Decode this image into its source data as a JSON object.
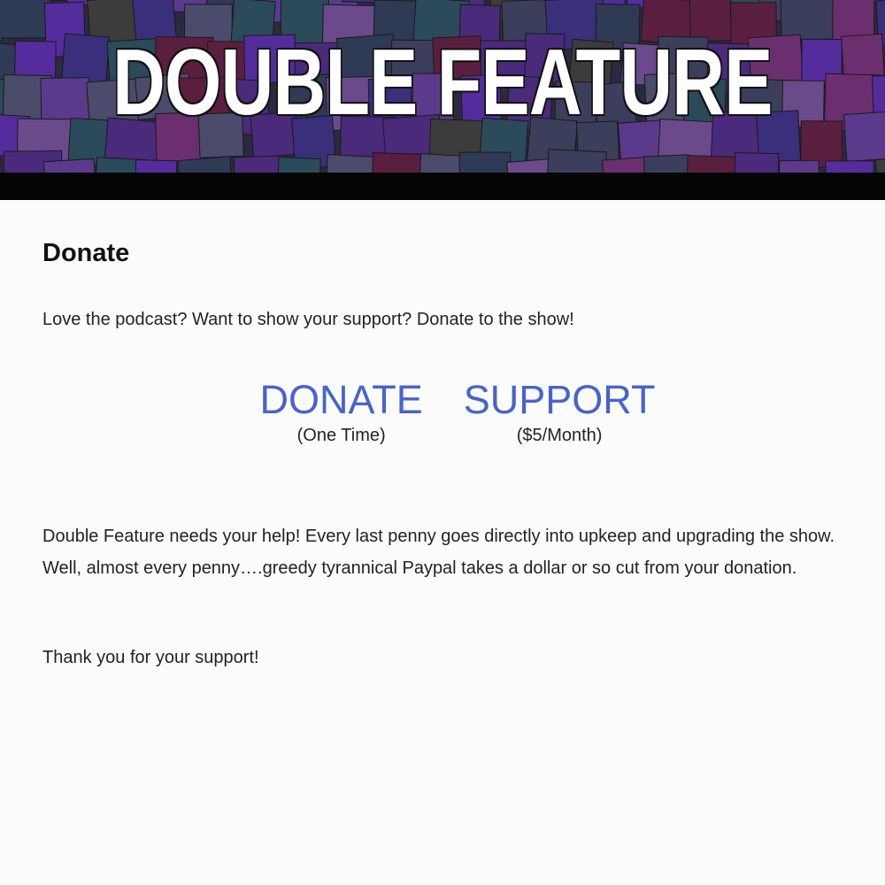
{
  "banner": {
    "title": "DOUBLE FEATURE"
  },
  "page": {
    "title": "Donate",
    "intro": "Love the podcast? Want to show your support? Donate to the show!",
    "body": "Double Feature needs your help! Every last penny goes directly into upkeep and upgrading the show. Well, almost every penny….greedy tyrannical Paypal takes a dollar or so cut from your donation.",
    "thanks": "Thank you for your support!"
  },
  "donate_options": {
    "one_time_label": "DONATE",
    "one_time_sub": "(One Time)",
    "monthly_label": "SUPPORT",
    "monthly_sub": "($5/Month)"
  },
  "colors": {
    "link": "#4763cf",
    "banner_palette": [
      "#3b3f5c",
      "#4a2a7a",
      "#5b3a8c",
      "#6b2f6f",
      "#2f3a55",
      "#4b4b6b",
      "#5a1f3f",
      "#3a2f7a",
      "#2b4a5a",
      "#6a4a8a",
      "#3c3c3c",
      "#542c9c"
    ]
  }
}
